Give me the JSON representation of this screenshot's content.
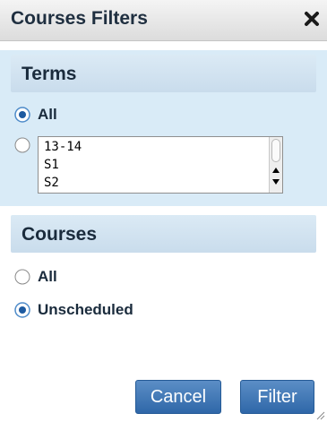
{
  "dialog": {
    "title": "Courses Filters",
    "close_icon": "close-icon"
  },
  "terms": {
    "heading": "Terms",
    "all_label": "All",
    "selected": "all",
    "list_options": [
      "13-14",
      "S1",
      "S2"
    ]
  },
  "courses": {
    "heading": "Courses",
    "all_label": "All",
    "unscheduled_label": "Unscheduled",
    "selected": "unscheduled"
  },
  "buttons": {
    "cancel_label": "Cancel",
    "filter_label": "Filter"
  },
  "colors": {
    "accent": "#2f67a8",
    "section_background": "#d9ebf7",
    "radio_selected": "#3a7fc9"
  }
}
